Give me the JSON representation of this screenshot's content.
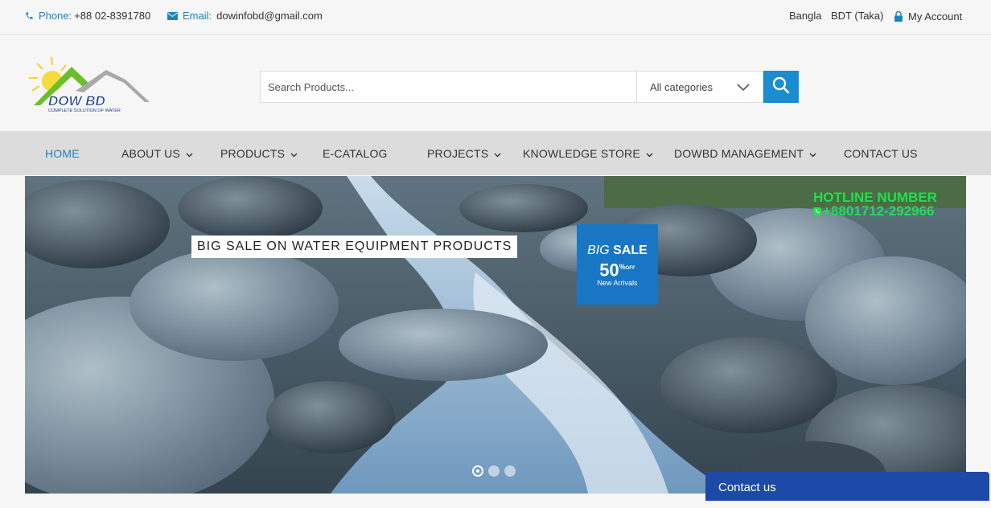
{
  "topbar": {
    "phone_label": "Phone:",
    "phone_value": "+88 02-8391780",
    "email_label": "Email:",
    "email_value": "dowinfobd@gmail.com",
    "language": "Bangla",
    "currency": "BDT (Taka)",
    "account": "My Account",
    "icons": [
      "phone-icon",
      "envelope-icon",
      "lock-icon"
    ]
  },
  "logo": {
    "brand": "DOW BD",
    "tagline": "COMPLETE SOLUTION OF WATER"
  },
  "search": {
    "placeholder": "Search Products...",
    "category": "All categories",
    "button_icon": "search-icon"
  },
  "nav": {
    "items": [
      {
        "label": "HOME",
        "active": true,
        "dropdown": false
      },
      {
        "label": "ABOUT US",
        "active": false,
        "dropdown": true
      },
      {
        "label": "PRODUCTS",
        "active": false,
        "dropdown": true
      },
      {
        "label": "E-CATALOG",
        "active": false,
        "dropdown": false
      },
      {
        "label": "PROJECTS",
        "active": false,
        "dropdown": true
      },
      {
        "label": "KNOWLEDGE STORE",
        "active": false,
        "dropdown": true
      },
      {
        "label": "DOWBD MANAGEMENT",
        "active": false,
        "dropdown": true
      },
      {
        "label": "CONTACT US",
        "active": false,
        "dropdown": false
      }
    ]
  },
  "hero": {
    "caption": "BIG SALE ON WATER EQUIPMENT PRODUCTS",
    "sale_big": "BIG",
    "sale_word": "SALE",
    "sale_percent": "50",
    "sale_pct_sign": "%",
    "sale_off": "OFF",
    "sale_sub": "New Arrivals",
    "hotline_title": "HOTLINE NUMBER",
    "hotline_number": "+8801712-292966",
    "slides": 3,
    "active_slide": 1
  },
  "contact_widget": {
    "label": "Contact us"
  },
  "colors": {
    "accent": "#1a84c5",
    "search_button": "#1a8dd1",
    "hotline": "#1ee14d",
    "contact_bar": "#1d4aa8"
  }
}
